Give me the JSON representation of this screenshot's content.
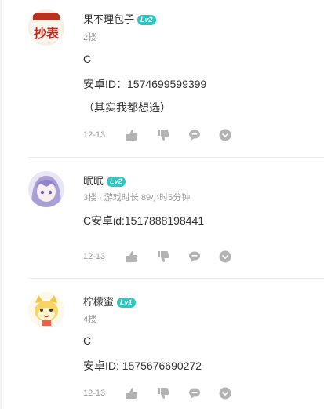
{
  "comments": [
    {
      "username": "果不理包子",
      "level": "Lv2",
      "floor": "2楼",
      "playtime": "",
      "lines": [
        "C",
        "安卓ID：1574699599399",
        "（其实我都想选）"
      ],
      "date": "12-13",
      "avatar_text": "抄表"
    },
    {
      "username": "眠眠",
      "level": "Lv2",
      "floor": "3楼",
      "playtime": "游戏时长 89小时5分钟",
      "lines": [
        "C安卓id:1517888198441"
      ],
      "date": "12-13"
    },
    {
      "username": "柠檬蜜",
      "level": "Lv1",
      "floor": "4楼",
      "playtime": "",
      "lines": [
        "C",
        "安卓ID: 1575676690272"
      ],
      "date": "12-13"
    }
  ],
  "icons": {
    "like": "thumbs-up-icon",
    "dislike": "thumbs-down-icon",
    "reply": "comment-bubble-icon",
    "more": "chevron-down-circle-icon"
  },
  "colors": {
    "level_badge": "#2fc5c0",
    "meta_text": "#999999",
    "icon": "#b3b3b3"
  }
}
